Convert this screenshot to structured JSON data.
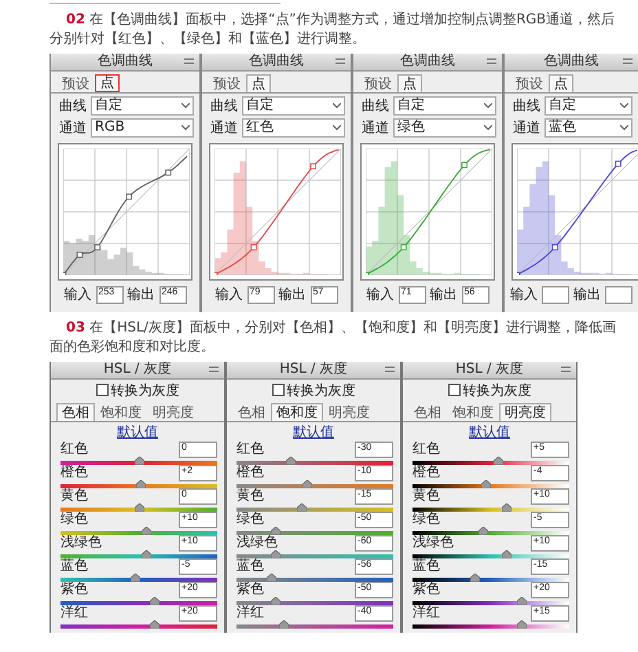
{
  "sections": [
    {
      "step": "02",
      "text": "在【色调曲线】面板中，选择“点”作为调整方式，通过增加控制点调整RGB通道，然后分别针对【红色】、【绿色】和【蓝色】进行调整。",
      "curves_panels": [
        {
          "title": "色调曲线",
          "tabs": [
            {
              "label": "预设",
              "selected": false,
              "highlighted": false
            },
            {
              "label": "点",
              "selected": true,
              "highlighted": true
            }
          ],
          "curve_label": "曲线",
          "curve_value": "自定",
          "channel_label": "通道",
          "channel_value": "RGB",
          "color": "#606060",
          "input_label": "输入",
          "input_value": "253",
          "output_label": "输出",
          "output_value": "246"
        },
        {
          "title": "色调曲线",
          "tabs": [
            {
              "label": "预设",
              "selected": false,
              "highlighted": false
            },
            {
              "label": "点",
              "selected": true,
              "highlighted": false
            }
          ],
          "curve_label": "曲线",
          "curve_value": "自定",
          "channel_label": "通道",
          "channel_value": "红色",
          "color": "#e04848",
          "input_label": "输入",
          "input_value": "79",
          "output_label": "输出",
          "output_value": "57"
        },
        {
          "title": "色调曲线",
          "tabs": [
            {
              "label": "预设",
              "selected": false,
              "highlighted": false
            },
            {
              "label": "点",
              "selected": true,
              "highlighted": false
            }
          ],
          "curve_label": "曲线",
          "curve_value": "自定",
          "channel_label": "通道",
          "channel_value": "绿色",
          "color": "#38a838",
          "input_label": "输入",
          "input_value": "71",
          "output_label": "输出",
          "output_value": "56"
        },
        {
          "title": "色调曲线",
          "tabs": [
            {
              "label": "预设",
              "selected": false,
              "highlighted": false
            },
            {
              "label": "点",
              "selected": true,
              "highlighted": false
            }
          ],
          "curve_label": "曲线",
          "curve_value": "自定",
          "channel_label": "通道",
          "channel_value": "蓝色",
          "color": "#4848d0",
          "input_label": "输入",
          "output_label": "输出"
        }
      ]
    },
    {
      "step": "03",
      "text": "在【HSL/灰度】面板中，分别对【色相】、【饱和度】和【明亮度】进行调整，降低画面的色彩饱和度和对比度。",
      "hsl_panels": [
        {
          "title": "HSL / 灰度",
          "grayscale_label": "转换为灰度",
          "grayscale_checked": false,
          "tabs": [
            {
              "label": "色相",
              "selected": true
            },
            {
              "label": "饱和度",
              "selected": false
            },
            {
              "label": "明亮度",
              "selected": false
            }
          ],
          "kind": "hue",
          "default_link": "默认值",
          "rows": [
            {
              "label": "红色",
              "value": "0",
              "level": 0.5
            },
            {
              "label": "橙色",
              "value": "+2",
              "level": 0.51
            },
            {
              "label": "黄色",
              "value": "0",
              "level": 0.5
            },
            {
              "label": "绿色",
              "value": "+10",
              "level": 0.55
            },
            {
              "label": "浅绿色",
              "value": "+10",
              "level": 0.55
            },
            {
              "label": "蓝色",
              "value": "-5",
              "level": 0.48
            },
            {
              "label": "紫色",
              "value": "+20",
              "level": 0.6
            },
            {
              "label": "洋红",
              "value": "+20",
              "level": 0.6
            }
          ]
        },
        {
          "title": "HSL / 灰度",
          "grayscale_label": "转换为灰度",
          "grayscale_checked": false,
          "tabs": [
            {
              "label": "色相",
              "selected": false
            },
            {
              "label": "饱和度",
              "selected": true
            },
            {
              "label": "明亮度",
              "selected": false
            }
          ],
          "kind": "saturation",
          "default_link": "默认值",
          "rows": [
            {
              "label": "红色",
              "value": "-30",
              "level": 0.35
            },
            {
              "label": "橙色",
              "value": "-10",
              "level": 0.45
            },
            {
              "label": "黄色",
              "value": "-15",
              "level": 0.42
            },
            {
              "label": "绿色",
              "value": "-50",
              "level": 0.25
            },
            {
              "label": "浅绿色",
              "value": "-60",
              "level": 0.25
            },
            {
              "label": "蓝色",
              "value": "-56",
              "level": 0.22
            },
            {
              "label": "紫色",
              "value": "-50",
              "level": 0.25
            },
            {
              "label": "洋红",
              "value": "-40",
              "level": 0.3
            }
          ]
        },
        {
          "title": "HSL / 灰度",
          "grayscale_label": "转换为灰度",
          "grayscale_checked": false,
          "tabs": [
            {
              "label": "色相",
              "selected": false
            },
            {
              "label": "饱和度",
              "selected": false
            },
            {
              "label": "明亮度",
              "selected": true
            }
          ],
          "kind": "luminance",
          "default_link": "默认值",
          "rows": [
            {
              "label": "红色",
              "value": "+5",
              "level": 0.55
            },
            {
              "label": "橙色",
              "value": "-4",
              "level": 0.47
            },
            {
              "label": "黄色",
              "value": "+10",
              "level": 0.6
            },
            {
              "label": "绿色",
              "value": "-5",
              "level": 0.45
            },
            {
              "label": "浅绿色",
              "value": "+10",
              "level": 0.6
            },
            {
              "label": "蓝色",
              "value": "-15",
              "level": 0.4
            },
            {
              "label": "紫色",
              "value": "+20",
              "level": 0.7
            },
            {
              "label": "洋红",
              "value": "+15",
              "level": 0.7
            }
          ]
        }
      ]
    }
  ]
}
